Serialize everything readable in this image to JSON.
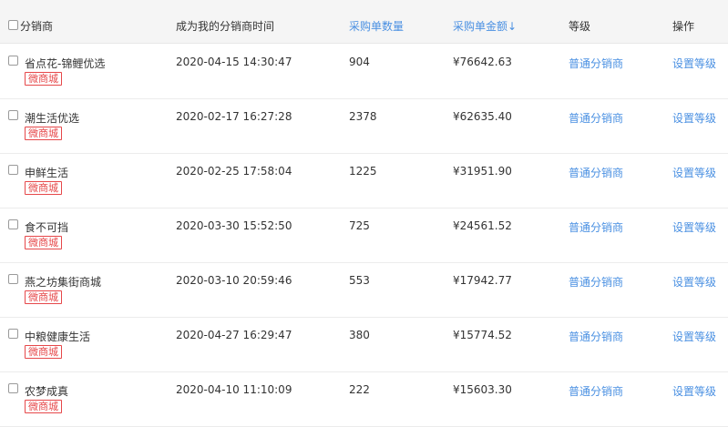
{
  "header": {
    "distributor": "分销商",
    "time": "成为我的分销商时间",
    "order_count": "采购单数量",
    "order_amount": "采购单金额↓",
    "level": "等级",
    "action": "操作"
  },
  "rows": [
    {
      "name": "省点花-锦鲤优选",
      "tag": "微商城",
      "time": "2020-04-15 14:30:47",
      "count": "904",
      "amount": "¥76642.63",
      "level": "普通分销商",
      "action": "设置等级"
    },
    {
      "name": "潮生活优选",
      "tag": "微商城",
      "time": "2020-02-17 16:27:28",
      "count": "2378",
      "amount": "¥62635.40",
      "level": "普通分销商",
      "action": "设置等级"
    },
    {
      "name": "申鲜生活",
      "tag": "微商城",
      "time": "2020-02-25 17:58:04",
      "count": "1225",
      "amount": "¥31951.90",
      "level": "普通分销商",
      "action": "设置等级"
    },
    {
      "name": "食不可挡",
      "tag": "微商城",
      "time": "2020-03-30 15:52:50",
      "count": "725",
      "amount": "¥24561.52",
      "level": "普通分销商",
      "action": "设置等级"
    },
    {
      "name": "燕之坊集街商城",
      "tag": "微商城",
      "time": "2020-03-10 20:59:46",
      "count": "553",
      "amount": "¥17942.77",
      "level": "普通分销商",
      "action": "设置等级"
    },
    {
      "name": "中粮健康生活",
      "tag": "微商城",
      "time": "2020-04-27 16:29:47",
      "count": "380",
      "amount": "¥15774.52",
      "level": "普通分销商",
      "action": "设置等级"
    },
    {
      "name": "农梦成真",
      "tag": "微商城",
      "time": "2020-04-10 11:10:09",
      "count": "222",
      "amount": "¥15603.30",
      "level": "普通分销商",
      "action": "设置等级"
    }
  ]
}
